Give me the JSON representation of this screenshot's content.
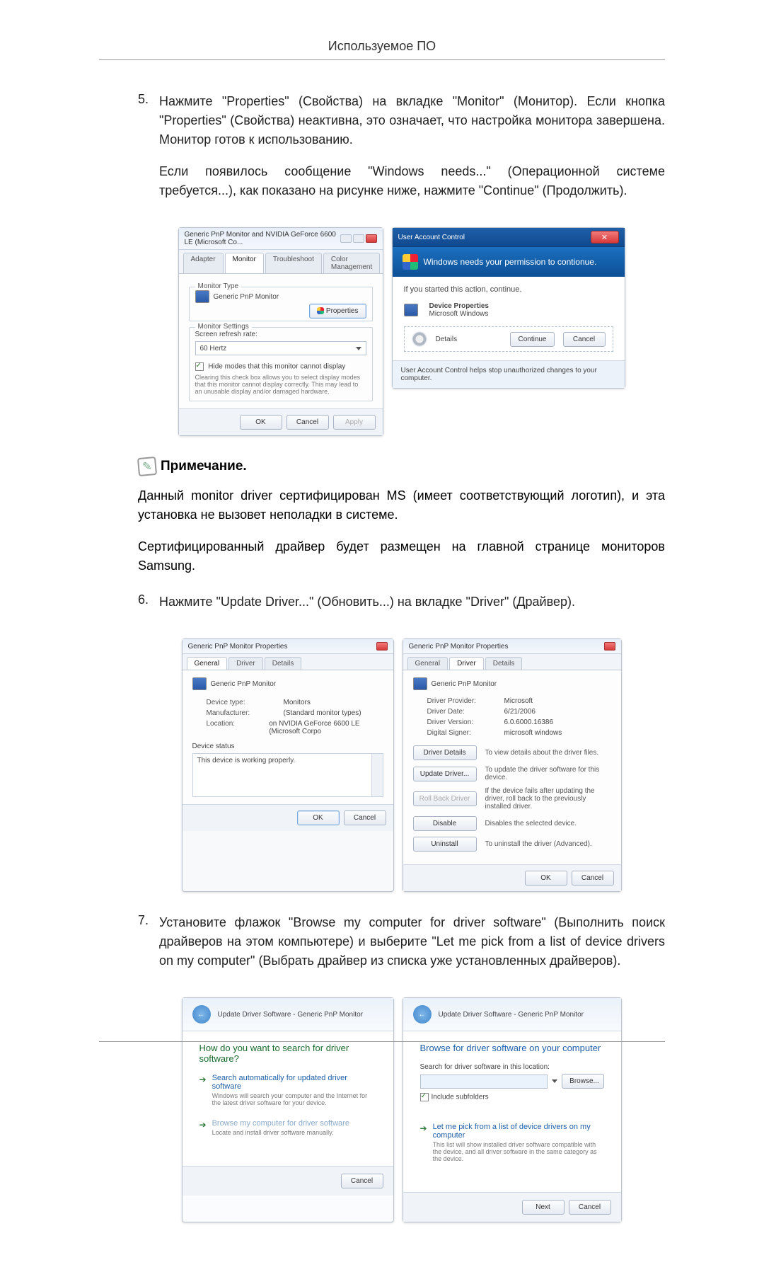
{
  "page_header": "Используемое ПО",
  "steps": {
    "s5": {
      "num": "5.",
      "p1": "Нажмите \"Properties\" (Свойства) на вкладке \"Monitor\" (Монитор). Если кнопка \"Properties\" (Свойства) неактивна, это означает, что настройка монитора завершена. Монитор готов к использованию.",
      "p2": "Если появилось сообщение \"Windows needs...\" (Операционной системе требуется...), как показано на рисунке ниже, нажмите \"Continue\" (Продолжить)."
    },
    "s6": {
      "num": "6.",
      "p1": "Нажмите \"Update Driver...\" (Обновить...) на вкладке \"Driver\" (Драйвер)."
    },
    "s7": {
      "num": "7.",
      "p1": "Установите флажок \"Browse my computer for driver software\" (Выполнить поиск драйверов на этом компьютере) и выберите \"Let me pick from a list of device drivers on my computer\" (Выбрать драйвер из списка уже установленных драйверов)."
    }
  },
  "note": {
    "title": "Примечание.",
    "p1": "Данный monitor driver сертифицирован MS (имеет соответствующий логотип), и эта установка не вызовет неполадки в системе.",
    "p2": "Сертифицированный драйвер будет размещен на главной странице мониторов Samsung."
  },
  "dlg_monitor": {
    "title": "Generic PnP Monitor and NVIDIA GeForce 6600 LE (Microsoft Co...",
    "tabs": {
      "adapter": "Adapter",
      "monitor": "Monitor",
      "troubleshoot": "Troubleshoot",
      "color": "Color Management"
    },
    "section_type": "Monitor Type",
    "device": "Generic PnP Monitor",
    "properties": "Properties",
    "section_settings": "Monitor Settings",
    "refresh_label": "Screen refresh rate:",
    "refresh_value": "60 Hertz",
    "hide_chk": "Hide modes that this monitor cannot display",
    "hide_desc": "Clearing this check box allows you to select display modes that this monitor cannot display correctly. This may lead to an unusable display and/or damaged hardware.",
    "ok": "OK",
    "cancel": "Cancel",
    "apply": "Apply"
  },
  "uac": {
    "title": "User Account Control",
    "banner": "Windows needs your permission to contionue.",
    "line1": "If you started this action, continue.",
    "dev1": "Device Properties",
    "dev2": "Microsoft Windows",
    "details": "Details",
    "continue": "Continue",
    "cancel": "Cancel",
    "footer": "User Account Control helps stop unauthorized changes to your computer."
  },
  "dlg_prop_general": {
    "title": "Generic PnP Monitor Properties",
    "tabs": {
      "general": "General",
      "driver": "Driver",
      "details": "Details"
    },
    "device": "Generic PnP Monitor",
    "rows": {
      "type_k": "Device type:",
      "type_v": "Monitors",
      "manu_k": "Manufacturer:",
      "manu_v": "(Standard monitor types)",
      "loc_k": "Location:",
      "loc_v": "on NVIDIA GeForce 6600 LE (Microsoft Corpo"
    },
    "status_label": "Device status",
    "status_text": "This device is working properly.",
    "ok": "OK",
    "cancel": "Cancel"
  },
  "dlg_prop_driver": {
    "title": "Generic PnP Monitor Properties",
    "device": "Generic PnP Monitor",
    "rows": {
      "prov_k": "Driver Provider:",
      "prov_v": "Microsoft",
      "date_k": "Driver Date:",
      "date_v": "6/21/2006",
      "ver_k": "Driver Version:",
      "ver_v": "6.0.6000.16386",
      "sign_k": "Digital Signer:",
      "sign_v": "microsoft windows"
    },
    "btns": {
      "details": "Driver Details",
      "details_d": "To view details about the driver files.",
      "update": "Update Driver...",
      "update_d": "To update the driver software for this device.",
      "rollback": "Roll Back Driver",
      "rollback_d": "If the device fails after updating the driver, roll back to the previously installed driver.",
      "disable": "Disable",
      "disable_d": "Disables the selected device.",
      "uninstall": "Uninstall",
      "uninstall_d": "To uninstall the driver (Advanced)."
    },
    "ok": "OK",
    "cancel": "Cancel"
  },
  "wiz1": {
    "bread": "Update Driver Software - Generic PnP Monitor",
    "heading": "How do you want to search for driver software?",
    "opt1_t": "Search automatically for updated driver software",
    "opt1_d": "Windows will search your computer and the Internet for the latest driver software for your device.",
    "opt2_t": "Browse my computer for driver software",
    "opt2_d": "Locate and install driver software manually.",
    "cancel": "Cancel"
  },
  "wiz2": {
    "bread": "Update Driver Software - Generic PnP Monitor",
    "heading": "Browse for driver software on your computer",
    "path_label": "Search for driver software in this location:",
    "browse": "Browse...",
    "include": "Include subfolders",
    "opt_t": "Let me pick from a list of device drivers on my computer",
    "opt_d": "This list will show installed driver software compatible with the device, and all driver software in the same category as the device.",
    "next": "Next",
    "cancel": "Cancel"
  }
}
